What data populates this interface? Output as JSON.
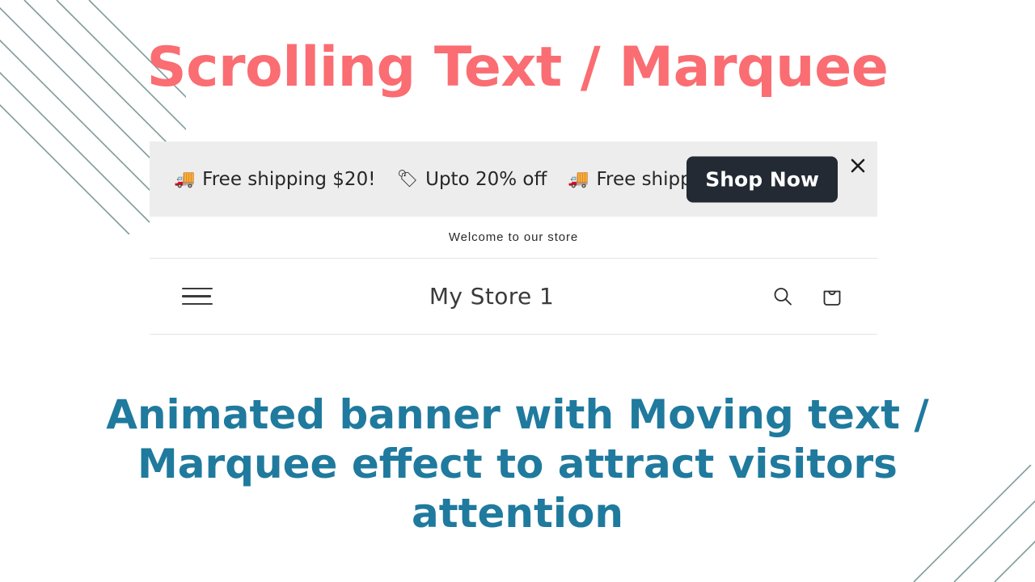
{
  "slide": {
    "title": "Scrolling Text / Marquee",
    "title_color": "#fa6d72",
    "caption_line1": "Animated banner with Moving text /",
    "caption_line2": "Marquee effect to attract visitors attention",
    "caption_color": "#1f7a9e",
    "background_color": "#ffffff",
    "decoration_line_color": "#7d9b9b"
  },
  "announcement_bar": {
    "background_color": "#ededed",
    "marquee_items": [
      {
        "emoji": "🚚",
        "emoji_name": "truck-emoji",
        "text": "Free shipping $20!"
      },
      {
        "emoji": "🏷",
        "emoji_name": "tag-emoji",
        "text": "Upto 20% off"
      },
      {
        "emoji": "🚚",
        "emoji_name": "truck-emoji",
        "text": "Free shipping"
      }
    ],
    "cta_label": "Shop Now",
    "cta_background_color": "#232a34",
    "cta_text_color": "#ffffff",
    "close_icon": "close-icon"
  },
  "welcome_bar": {
    "message": "Welcome to our store"
  },
  "store_header": {
    "menu_icon": "hamburger-menu-icon",
    "store_name": "My Store 1",
    "search_icon": "search-icon",
    "cart_icon": "shopping-bag-icon"
  }
}
